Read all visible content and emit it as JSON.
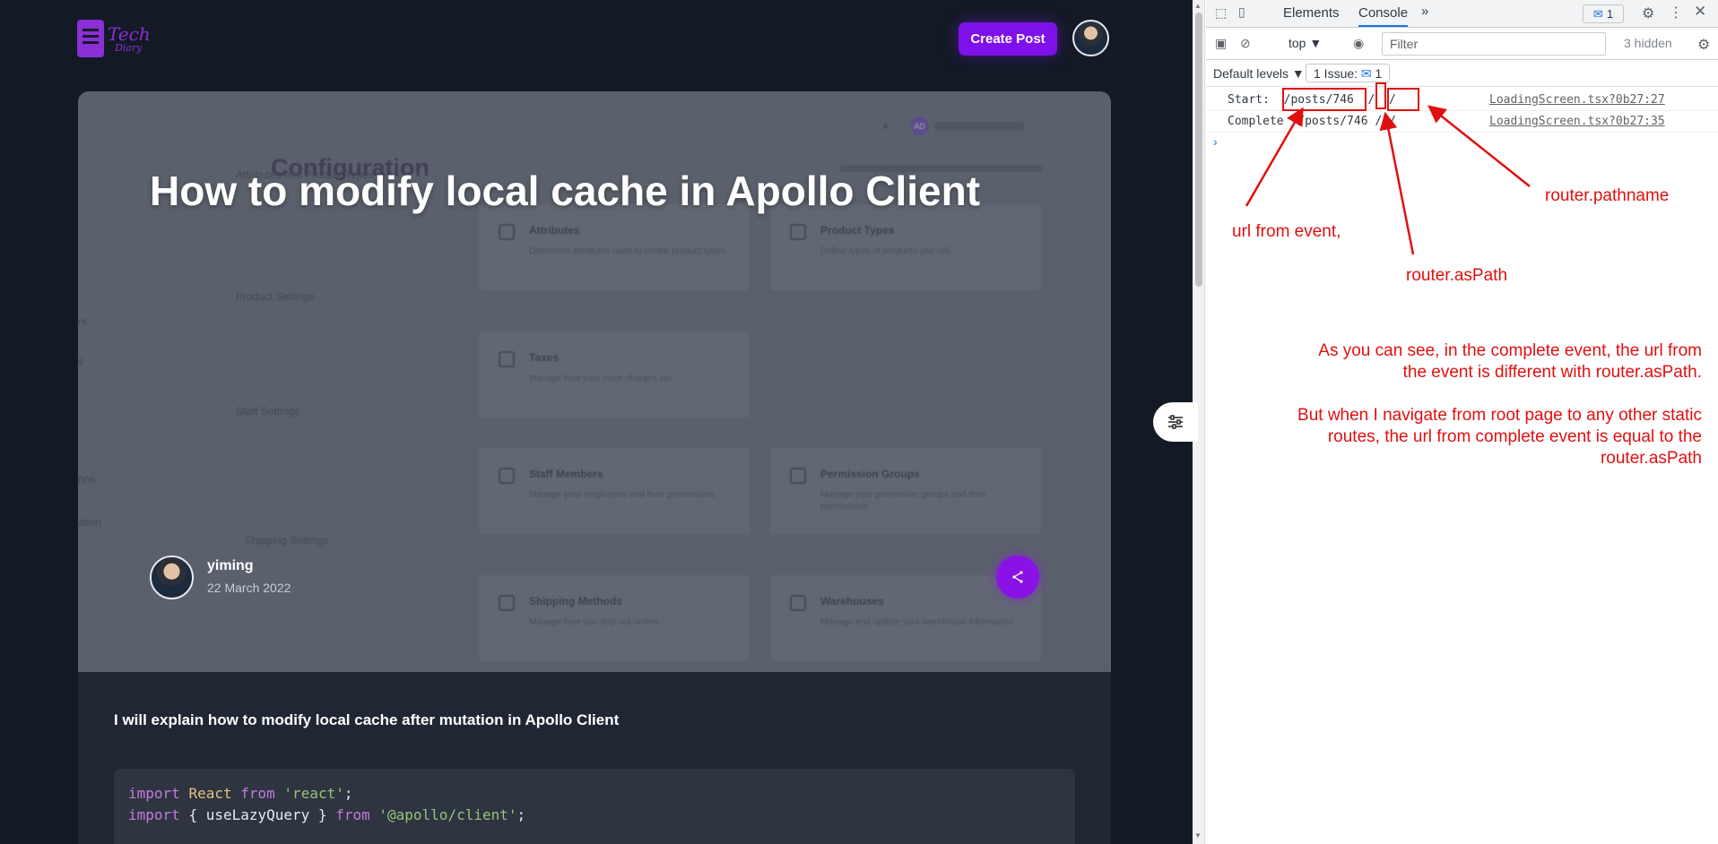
{
  "app": {
    "logo_line1": "Tech",
    "logo_line2": "Diary",
    "create_post_label": "Create Post"
  },
  "post": {
    "title": "How to modify local cache in Apollo Client",
    "author": "yiming",
    "date": "22 March 2022",
    "intro": "I will explain how to modify local cache after mutation in Apollo Client",
    "code_line1": {
      "kw1": "import",
      "id": "React",
      "kw2": "from",
      "str": "'react'",
      "end": ";"
    },
    "code_line2": {
      "kw1": "import",
      "mid": "{ useLazyQuery }",
      "kw2": "from",
      "str": "'@apollo/client'",
      "end": ";"
    }
  },
  "screenshot_bg": {
    "config_title": "Configuration",
    "attrs_sub": "Attributes and Product Types",
    "product_settings": "Product Settings",
    "staff_settings": "Staff Settings",
    "shipping_settings": "Shipping Settings",
    "nav_1": "rs",
    "nav_2": "s",
    "nav_3": "ons",
    "nav_4": "ation",
    "badge": "AD",
    "cards": [
      {
        "title": "Attributes",
        "desc": "Determine attributes used to create product types"
      },
      {
        "title": "Product Types",
        "desc": "Define types of products you sell"
      },
      {
        "title": "Taxes",
        "desc": "Manage how your store charges tax"
      },
      {
        "title": "Staff Members",
        "desc": "Manage your employees and their permissions"
      },
      {
        "title": "Permission Groups",
        "desc": "Manage your permission groups and their permissions"
      },
      {
        "title": "Shipping Methods",
        "desc": "Manage how you ship out orders"
      },
      {
        "title": "Warehouses",
        "desc": "Manage and update your warehouse information"
      }
    ]
  },
  "devtools": {
    "tab_elements": "Elements",
    "tab_console": "Console",
    "more_tabs": "»",
    "issues_badge_count": "1",
    "context": "top ▼",
    "filter_placeholder": "Filter",
    "hidden_count": "3 hidden",
    "default_levels": "Default levels ▼",
    "issues_label": "1 Issue:",
    "issues_count": "1",
    "lines": [
      {
        "text": "Start:  /posts/746  /  /",
        "source": "LoadingScreen.tsx?0b27:27"
      },
      {
        "text": "Complete  /posts/746 / /",
        "source": "LoadingScreen.tsx?0b27:35"
      }
    ],
    "prompt": "›"
  },
  "annotations": {
    "url_from_event": "url from event,",
    "router_aspath": "router.asPath",
    "router_pathname": "router.pathname",
    "para1_line1": "As you can see, in the complete event, the url from",
    "para1_line2": "the event is different with router.asPath.",
    "para2_line1": "But when I navigate from root page to any other static",
    "para2_line2": "routes, the url from complete event is equal to the",
    "para2_line3": "router.asPath",
    "color": "#e01010"
  },
  "colors": {
    "accent_purple": "#7e10ea",
    "devtools_blue": "#1a73e8"
  }
}
